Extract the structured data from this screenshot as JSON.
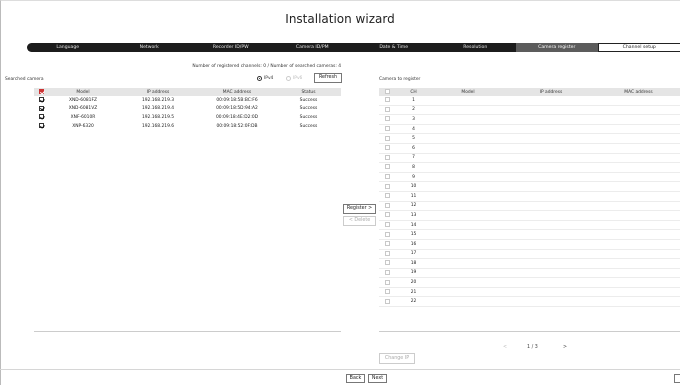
{
  "window": {
    "title": "Installation wizard"
  },
  "steps": [
    {
      "label": "Language",
      "state": "done"
    },
    {
      "label": "Network",
      "state": "done"
    },
    {
      "label": "Recorder ID/PW",
      "state": "done"
    },
    {
      "label": "Camera ID/PM",
      "state": "done"
    },
    {
      "label": "Date & Time",
      "state": "done"
    },
    {
      "label": "Resolution",
      "state": "done"
    },
    {
      "label": "Camera register",
      "state": "active"
    },
    {
      "label": "Channel setup",
      "state": "next"
    }
  ],
  "searched": {
    "count_text": "Number of registered channels: 0 / Number of searched cameras: 4",
    "heading": "Searched camera",
    "ipv4_label": "IPv4",
    "ipv6_label": "IPv6",
    "refresh_label": "Refresh",
    "columns": [
      "Model",
      "IP address",
      "MAC address",
      "Status"
    ],
    "rows": [
      {
        "model": "XND-6081FZ",
        "ip": "192.168.219.3",
        "mac": "00:09:18:5B:BC:F6",
        "status": "Success"
      },
      {
        "model": "XND-6081VZ",
        "ip": "192.168.219.4",
        "mac": "00:09:18:5D:94:A2",
        "status": "Success"
      },
      {
        "model": "XNF-6010R",
        "ip": "192.168.219.5",
        "mac": "00:09:18:4E:D2:0D",
        "status": "Success"
      },
      {
        "model": "XNP-6320",
        "ip": "192.168.219.6",
        "mac": "00:09:18:52:0F:DB",
        "status": "Success"
      }
    ]
  },
  "actions": {
    "register_label": "Register >",
    "delete_label": "< Delete"
  },
  "register": {
    "heading": "Camera to register",
    "columns": [
      "CH",
      "Model",
      "IP address",
      "MAC address"
    ],
    "channels": [
      "1",
      "2",
      "3",
      "4",
      "5",
      "6",
      "7",
      "8",
      "9",
      "10",
      "11",
      "12",
      "13",
      "14",
      "15",
      "16",
      "17",
      "18",
      "19",
      "20",
      "21",
      "22"
    ],
    "change_ip_label": "Change IP",
    "pager": {
      "prev": "<",
      "page": "1 / 3",
      "next": ">"
    }
  },
  "footer": {
    "back_label": "Back",
    "next_label": "Next"
  }
}
